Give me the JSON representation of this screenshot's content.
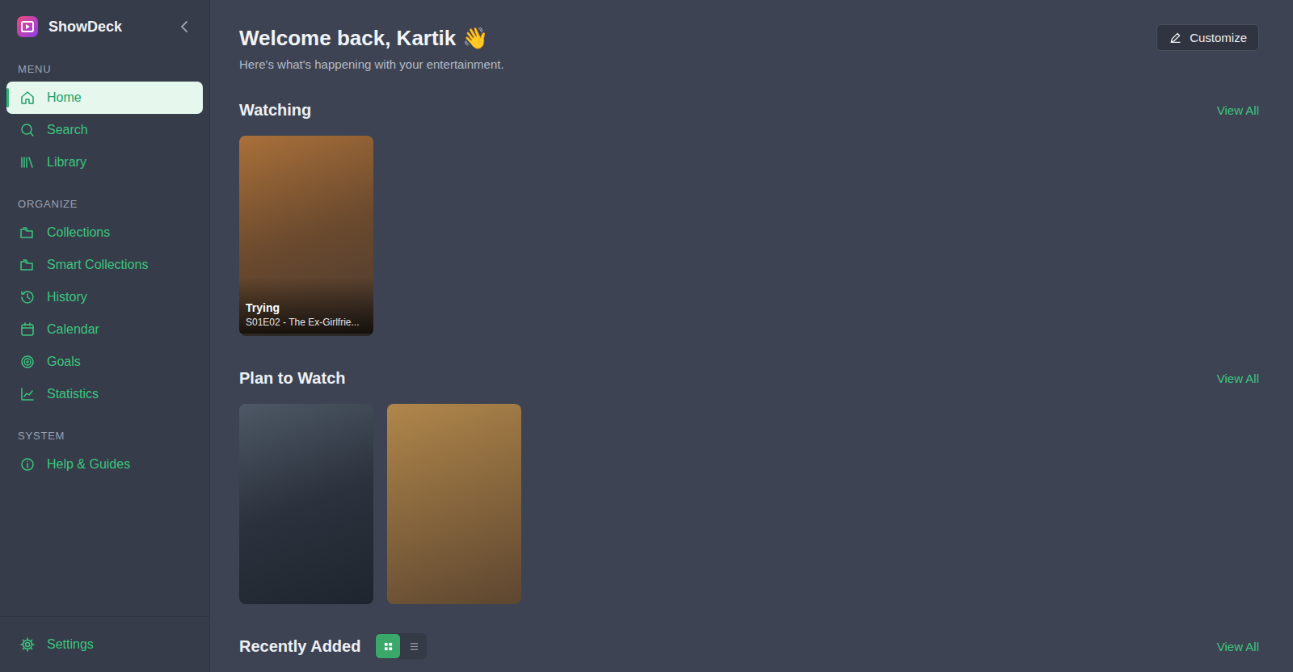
{
  "app": {
    "name": "ShowDeck"
  },
  "sidebar": {
    "sections": [
      {
        "label": "MENU",
        "items": [
          {
            "label": "Home",
            "selected": true
          },
          {
            "label": "Search",
            "selected": false
          },
          {
            "label": "Library",
            "selected": false
          }
        ]
      },
      {
        "label": "ORGANIZE",
        "items": [
          {
            "label": "Collections",
            "selected": false
          },
          {
            "label": "Smart Collections",
            "selected": false
          },
          {
            "label": "History",
            "selected": false
          },
          {
            "label": "Calendar",
            "selected": false
          },
          {
            "label": "Goals",
            "selected": false
          },
          {
            "label": "Statistics",
            "selected": false
          }
        ]
      },
      {
        "label": "SYSTEM",
        "items": [
          {
            "label": "Help & Guides",
            "selected": false
          }
        ]
      }
    ],
    "footer": {
      "label": "Settings",
      "selected": false
    }
  },
  "header": {
    "title": "Welcome back, Kartik 👋",
    "subtitle": "Here's what's happening with your entertainment.",
    "button": "Customize"
  },
  "sections": [
    {
      "title": "Watching",
      "link": "View All",
      "view_modes": [],
      "cards": [
        {
          "kind": "episode",
          "title": "Trying",
          "subtitle": "S01E02 - The Ex-Girlfrie...",
          "level": 0.02
        }
      ]
    },
    {
      "title": "Plan to Watch",
      "link": "View All",
      "view_modes": [],
      "cards": [
        {
          "kind": "poster"
        },
        {
          "kind": "poster"
        }
      ]
    },
    {
      "title": "Recently Added",
      "link": "View All",
      "view_modes": [
        {
          "kind": "grid",
          "selected": true
        },
        {
          "kind": "list",
          "selected": false
        }
      ],
      "cards": [
        {
          "kind": "poster"
        },
        {
          "kind": "poster"
        },
        {
          "kind": "poster"
        },
        {
          "kind": "poster"
        }
      ]
    }
  ]
}
